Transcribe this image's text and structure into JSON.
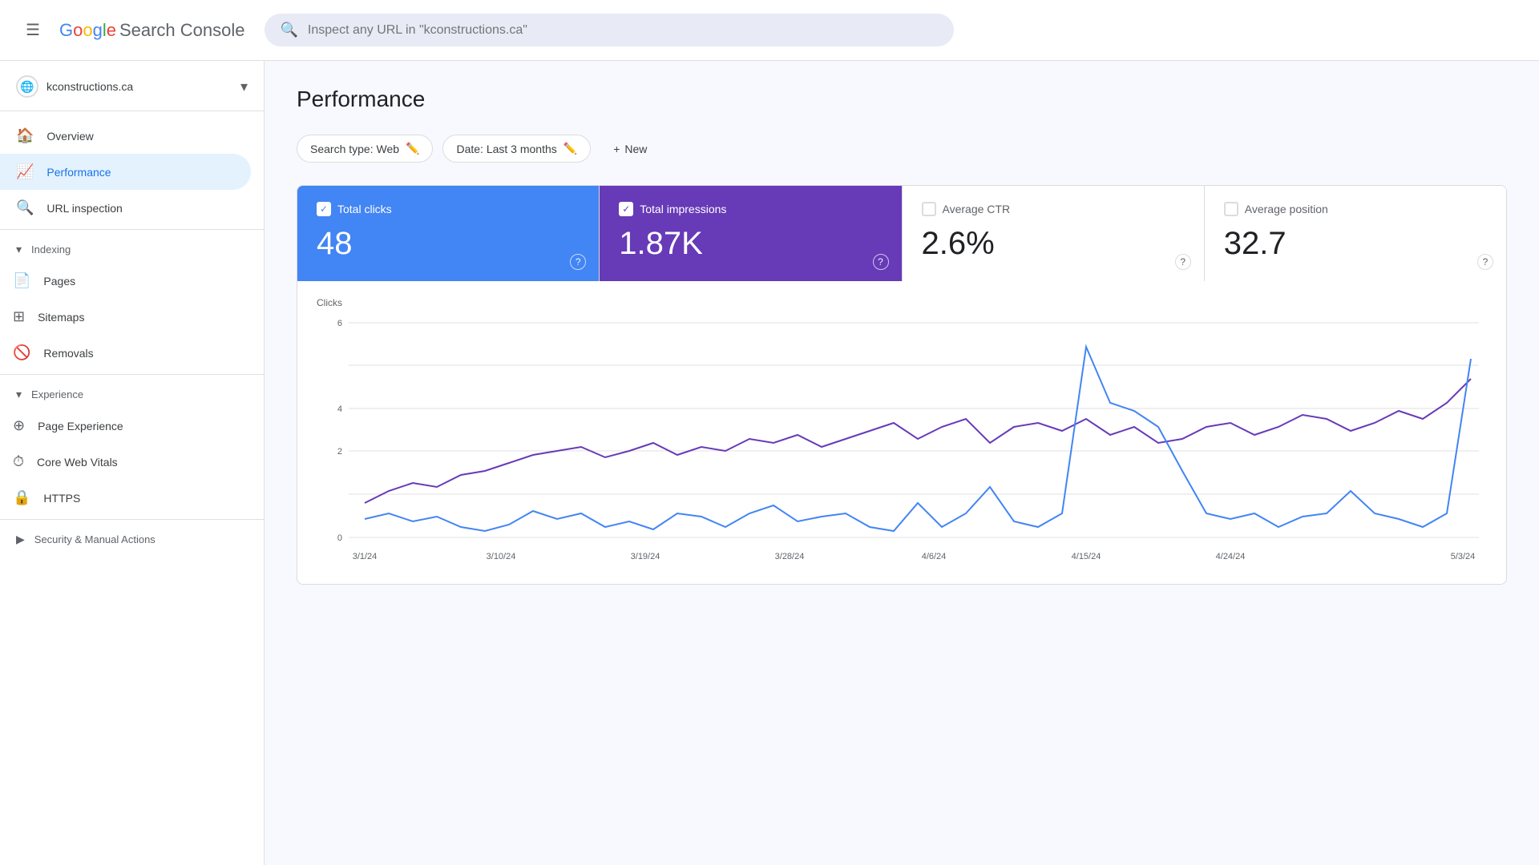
{
  "header": {
    "menu_icon": "☰",
    "logo": {
      "G": "G",
      "o1": "o",
      "o2": "o",
      "g": "g",
      "l": "l",
      "e": "e",
      "service": "Search Console"
    },
    "search_placeholder": "Inspect any URL in \"kconstructions.ca\""
  },
  "property": {
    "name": "kconstructions.ca",
    "icon": "🌐"
  },
  "nav": {
    "overview": "Overview",
    "performance": "Performance",
    "url_inspection": "URL inspection",
    "indexing_section": "Indexing",
    "pages": "Pages",
    "sitemaps": "Sitemaps",
    "removals": "Removals",
    "experience_section": "Experience",
    "page_experience": "Page Experience",
    "core_web_vitals": "Core Web Vitals",
    "https": "HTTPS",
    "security_manual": "Security & Manual Actions"
  },
  "page": {
    "title": "Performance"
  },
  "filters": {
    "search_type": "Search type: Web",
    "date": "Date: Last 3 months",
    "new_label": "New",
    "edit_icon": "✏️",
    "plus_icon": "+"
  },
  "metrics": {
    "total_clicks": {
      "label": "Total clicks",
      "value": "48",
      "state": "active_blue"
    },
    "total_impressions": {
      "label": "Total impressions",
      "value": "1.87K",
      "state": "active_purple"
    },
    "average_ctr": {
      "label": "Average CTR",
      "value": "2.6%",
      "state": "inactive"
    },
    "average_position": {
      "label": "Average position",
      "value": "32.7",
      "state": "inactive"
    }
  },
  "chart": {
    "y_label": "Clicks",
    "y_max": 6,
    "y_ticks": [
      0,
      2,
      4,
      6
    ],
    "x_labels": [
      "3/1/24",
      "3/10/24",
      "3/19/24",
      "3/28/24",
      "4/6/24",
      "4/15/24",
      "4/24/24",
      "5/3/24"
    ],
    "help_icon": "?"
  }
}
